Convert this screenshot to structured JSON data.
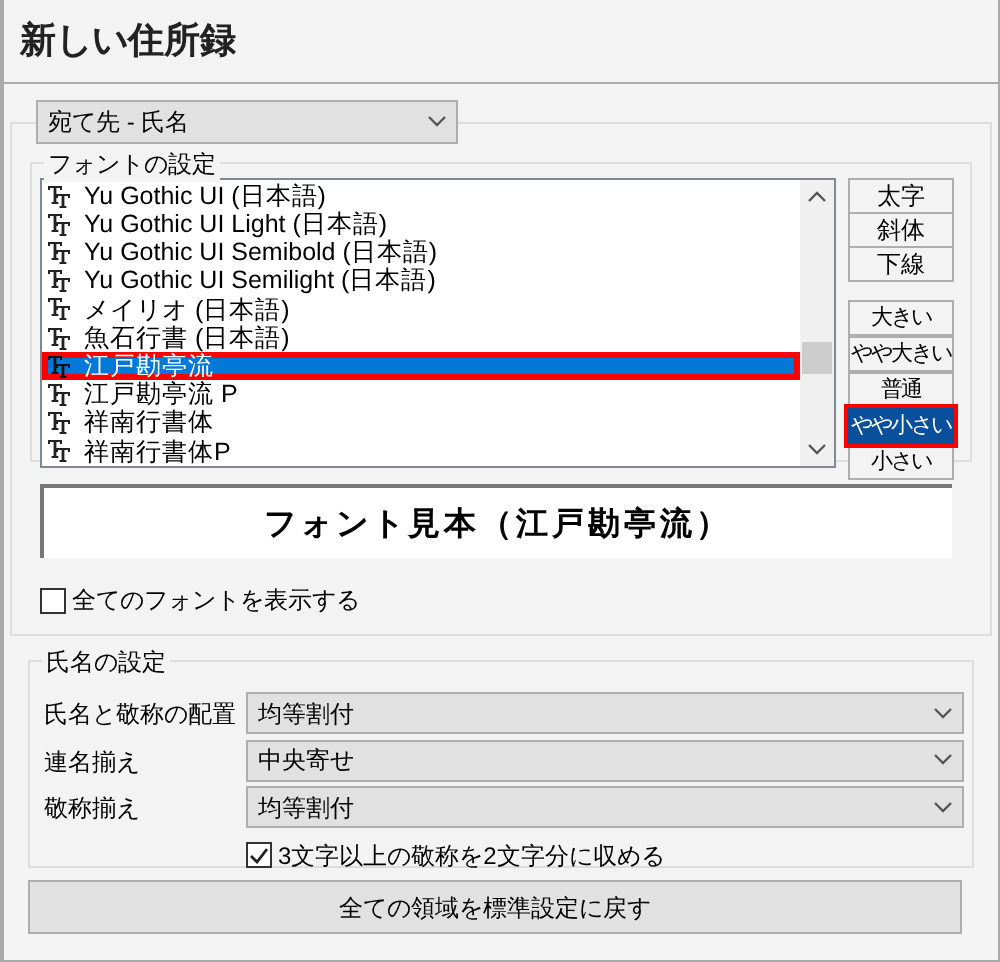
{
  "window": {
    "title": "新しい住所録"
  },
  "target_dropdown": {
    "value": "宛て先 - 氏名"
  },
  "font_settings": {
    "label": "フォントの設定",
    "fonts": [
      {
        "name": "Yu Gothic UI (日本語)",
        "selected": false,
        "highlighted": false
      },
      {
        "name": "Yu Gothic UI Light (日本語)",
        "selected": false,
        "highlighted": false
      },
      {
        "name": "Yu Gothic UI Semibold (日本語)",
        "selected": false,
        "highlighted": false
      },
      {
        "name": "Yu Gothic UI Semilight (日本語)",
        "selected": false,
        "highlighted": false
      },
      {
        "name": "メイリオ (日本語)",
        "selected": false,
        "highlighted": false
      },
      {
        "name": "魚石行書 (日本語)",
        "selected": false,
        "highlighted": false
      },
      {
        "name": "江戸勘亭流",
        "selected": true,
        "highlighted": true
      },
      {
        "name": "江戸勘亭流 P",
        "selected": false,
        "highlighted": false
      },
      {
        "name": "祥南行書体",
        "selected": false,
        "highlighted": false
      },
      {
        "name": "祥南行書体P",
        "selected": false,
        "highlighted": false
      }
    ],
    "style_buttons": [
      {
        "label": "太字"
      },
      {
        "label": "斜体"
      },
      {
        "label": "下線"
      }
    ],
    "size_buttons": [
      {
        "label": "大きい",
        "selected": false,
        "highlighted": false
      },
      {
        "label": "やや大きい",
        "selected": false,
        "highlighted": false
      },
      {
        "label": "普通",
        "selected": false,
        "highlighted": false
      },
      {
        "label": "やや小さい",
        "selected": true,
        "highlighted": true
      },
      {
        "label": "小さい",
        "selected": false,
        "highlighted": false
      }
    ],
    "preview": "フォント見本（江戸勘亭流）",
    "show_all_fonts": {
      "label": "全てのフォントを表示する",
      "checked": false
    }
  },
  "name_settings": {
    "label": "氏名の設定",
    "rows": [
      {
        "label": "氏名と敬称の配置",
        "value": "均等割付"
      },
      {
        "label": "連名揃え",
        "value": "中央寄せ"
      },
      {
        "label": "敬称揃え",
        "value": "均等割付"
      }
    ],
    "fit_honorific": {
      "label": "3文字以上の敬称を2文字分に収める",
      "checked": true
    }
  },
  "reset_button": "全ての領域を標準設定に戻す"
}
